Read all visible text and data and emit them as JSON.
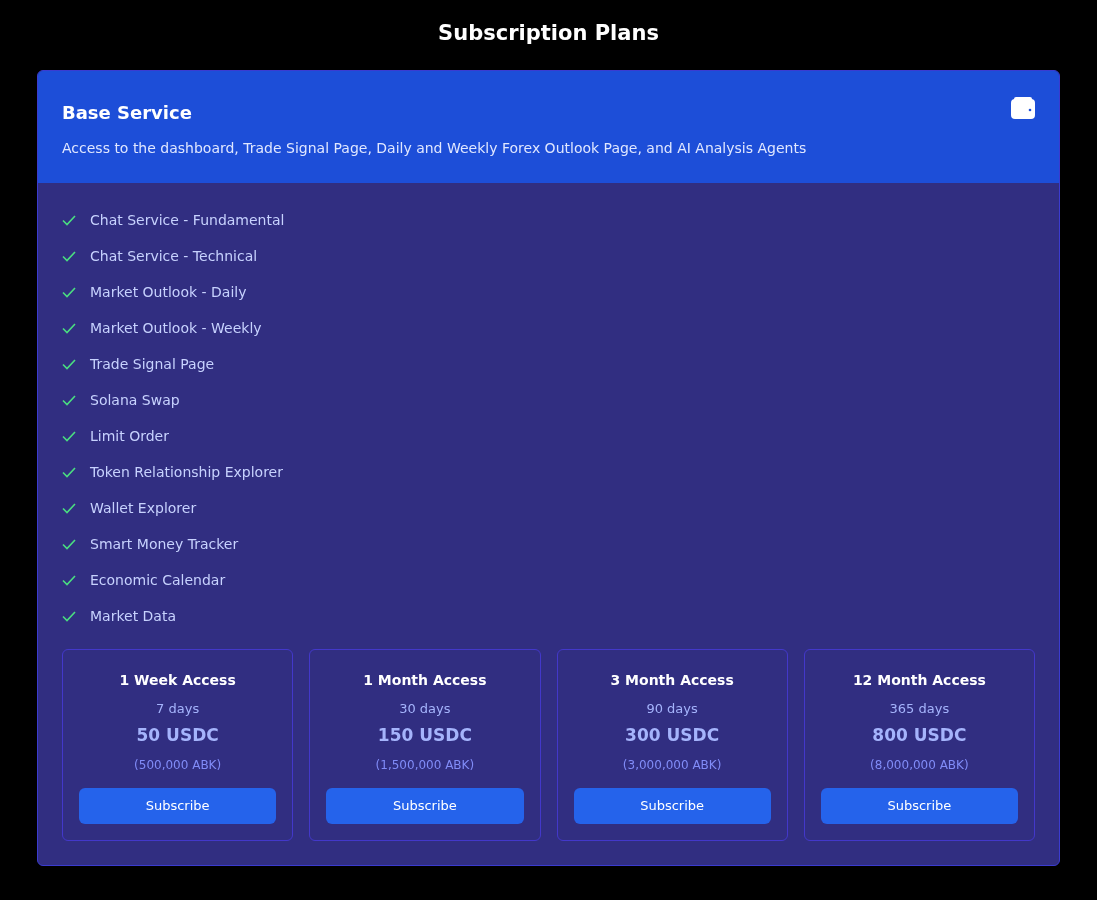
{
  "page_title": "Subscription Plans",
  "plan": {
    "title": "Base Service",
    "description": "Access to the dashboard, Trade Signal Page, Daily and Weekly Forex Outlook Page, and AI Analysis Agents",
    "features": [
      "Chat Service - Fundamental",
      "Chat Service - Technical",
      "Market Outlook - Daily",
      "Market Outlook - Weekly",
      "Trade Signal Page",
      "Solana Swap",
      "Limit Order",
      "Token Relationship Explorer",
      "Wallet Explorer",
      "Smart Money Tracker",
      "Economic Calendar",
      "Market Data"
    ],
    "options": [
      {
        "name": "1 Week Access",
        "duration": "7 days",
        "price": "50 USDC",
        "alt_price": "(500,000 ABK)",
        "button": "Subscribe"
      },
      {
        "name": "1 Month Access",
        "duration": "30 days",
        "price": "150 USDC",
        "alt_price": "(1,500,000 ABK)",
        "button": "Subscribe"
      },
      {
        "name": "3 Month Access",
        "duration": "90 days",
        "price": "300 USDC",
        "alt_price": "(3,000,000 ABK)",
        "button": "Subscribe"
      },
      {
        "name": "12 Month Access",
        "duration": "365 days",
        "price": "800 USDC",
        "alt_price": "(8,000,000 ABK)",
        "button": "Subscribe"
      }
    ]
  }
}
